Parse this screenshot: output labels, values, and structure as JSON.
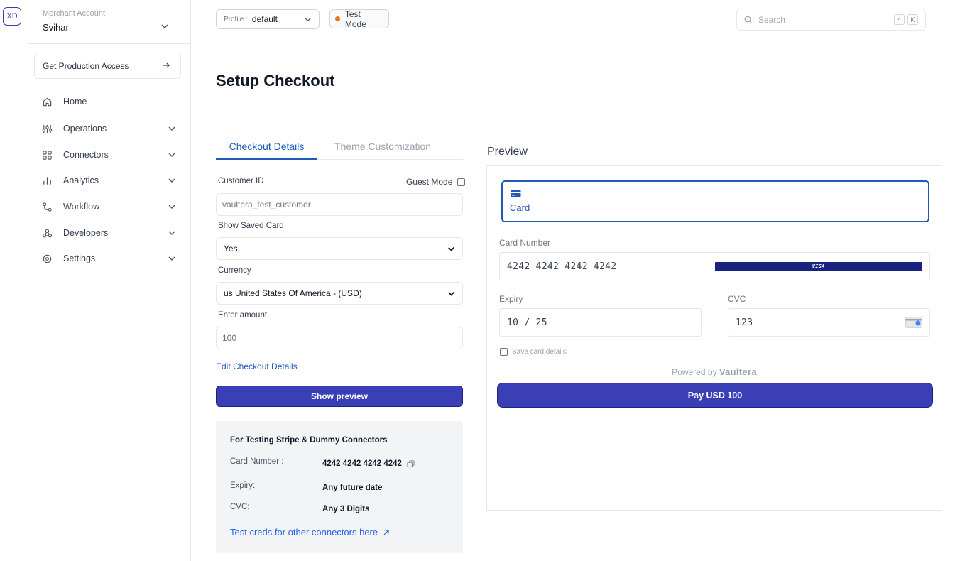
{
  "rail": {
    "org_badge": "XD"
  },
  "sidebar": {
    "merchant_label": "Merchant Account",
    "merchant_name": "Svihar",
    "production_access": "Get Production Access",
    "items": [
      {
        "label": "Home",
        "icon": "home-icon"
      },
      {
        "label": "Operations",
        "icon": "operations-icon"
      },
      {
        "label": "Connectors",
        "icon": "connectors-icon"
      },
      {
        "label": "Analytics",
        "icon": "analytics-icon"
      },
      {
        "label": "Workflow",
        "icon": "workflow-icon"
      },
      {
        "label": "Developers",
        "icon": "developers-icon"
      },
      {
        "label": "Settings",
        "icon": "settings-icon"
      }
    ]
  },
  "topbar": {
    "profile_prefix": "Profile :",
    "profile_value": "default",
    "test_mode": "Test Mode",
    "search_placeholder": "Search",
    "shortcut_keys": [
      "^",
      "K"
    ]
  },
  "page": {
    "title": "Setup Checkout"
  },
  "tabs": {
    "checkout_details": "Checkout Details",
    "theme_customization": "Theme Customization"
  },
  "form": {
    "customer_id_label": "Customer ID",
    "guest_mode_label": "Guest Mode",
    "customer_id_placeholder": "vaultera_test_customer",
    "show_saved_card_label": "Show Saved Card",
    "show_saved_card_value": "Yes",
    "currency_label": "Currency",
    "currency_value": "us United States Of America - (USD)",
    "amount_label": "Enter amount",
    "amount_value": "100",
    "edit_link": "Edit Checkout Details",
    "show_preview_button": "Show preview"
  },
  "testing": {
    "title": "For Testing Stripe & Dummy Connectors",
    "card_number_label": "Card Number :",
    "card_number_value": "4242 4242 4242 4242",
    "expiry_label": "Expiry:",
    "expiry_value": "Any future date",
    "cvc_label": "CVC:",
    "cvc_value": "Any 3 Digits",
    "link": "Test creds for other connectors here"
  },
  "preview": {
    "title": "Preview",
    "card_tab": "Card",
    "card_number_label": "Card Number",
    "card_number_value": "4242 4242 4242 4242",
    "card_brand": "VISA",
    "expiry_label": "Expiry",
    "expiry_value": "10 / 25",
    "cvc_label": "CVC",
    "cvc_value": "123",
    "save_card_label": "Save card details",
    "powered_by": "Powered by",
    "powered_brand": "Vaultera",
    "pay_button": "Pay USD 100"
  },
  "colors": {
    "accent": "#3b3fb5",
    "link": "#1e5bb8",
    "test_dot": "#f97316"
  }
}
